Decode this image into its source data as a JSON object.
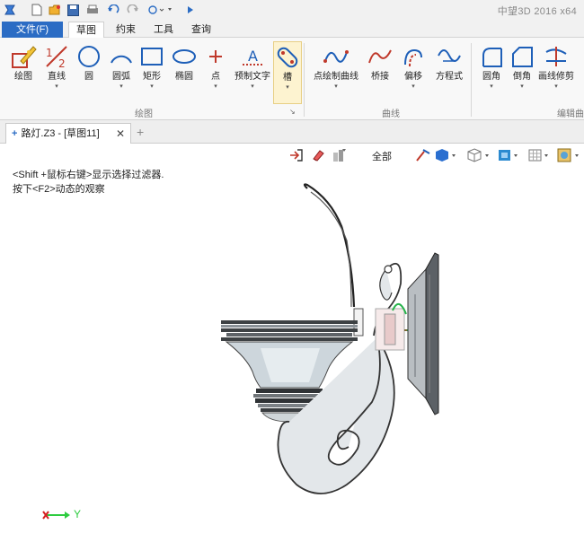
{
  "app": {
    "title": "中望3D 2016  x64"
  },
  "ribbon_tabs": {
    "file": "文件(F)",
    "sketch": "草图",
    "constraint": "约束",
    "tools": "工具",
    "query": "查询"
  },
  "draw_group": {
    "label": "绘图",
    "buttons": {
      "draw": "绘图",
      "line": "直线",
      "circle": "圆",
      "arc": "圆弧",
      "rect": "矩形",
      "ellipse": "椭圆",
      "point": "点",
      "pretext": "预制文字",
      "slot": "槽"
    }
  },
  "curve_group": {
    "label": "曲线",
    "buttons": {
      "point_curve": "点绘制曲线",
      "bridge": "桥接",
      "offset": "偏移",
      "equation": "方程式"
    }
  },
  "edit_group": {
    "label": "编辑曲",
    "buttons": {
      "fillet": "圆角",
      "chamfer": "倒角",
      "trim": "画线修剪"
    }
  },
  "document": {
    "tab_title": "路灯.Z3 - [草图11]",
    "marker": "+"
  },
  "canvas": {
    "hint1": "<Shift +鼠标右键>显示选择过滤器.",
    "hint2": "按下<F2>动态的观察",
    "filter": "全部",
    "axis_label": "Y"
  },
  "colors": {
    "accent": "#2b6cc4",
    "icon_red": "#c0392b",
    "axis_green": "#2ecc40",
    "axis_red": "#d62020"
  },
  "icons": [
    "app-logo-icon",
    "new-file-icon",
    "open-folder-icon",
    "save-icon",
    "print-icon",
    "undo-icon",
    "redo-icon",
    "pointer-icon",
    "exit-sketch-icon",
    "eraser-icon",
    "filter-icon",
    "pick-icon",
    "shading-icon",
    "view-cube-icon",
    "layer-icon",
    "grid-icon",
    "render-icon"
  ]
}
